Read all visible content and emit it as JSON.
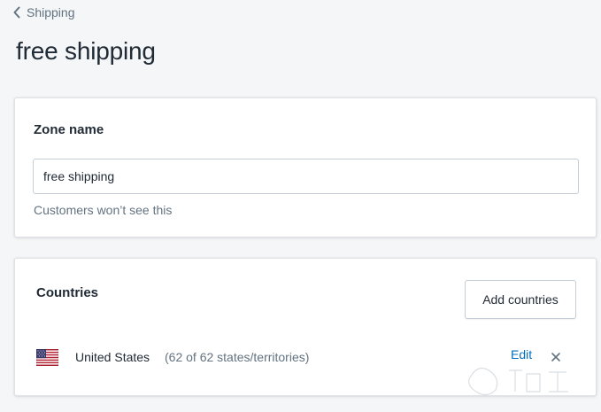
{
  "breadcrumb": {
    "label": "Shipping",
    "icon": "chevron-left-icon"
  },
  "page": {
    "title": "free shipping"
  },
  "zone": {
    "title": "Zone name",
    "input_value": "free shipping",
    "help_text": "Customers won’t see this"
  },
  "countries": {
    "title": "Countries",
    "add_button": "Add countries",
    "rows": [
      {
        "flag": "us-flag-icon",
        "name": "United States",
        "detail": "(62 of 62 states/territories)",
        "edit_label": "Edit",
        "remove_icon": "close-icon"
      }
    ]
  },
  "colors": {
    "background": "#f4f6f8",
    "card": "#ffffff",
    "link": "#006fbb",
    "muted_text": "#637381",
    "text": "#212b36"
  }
}
